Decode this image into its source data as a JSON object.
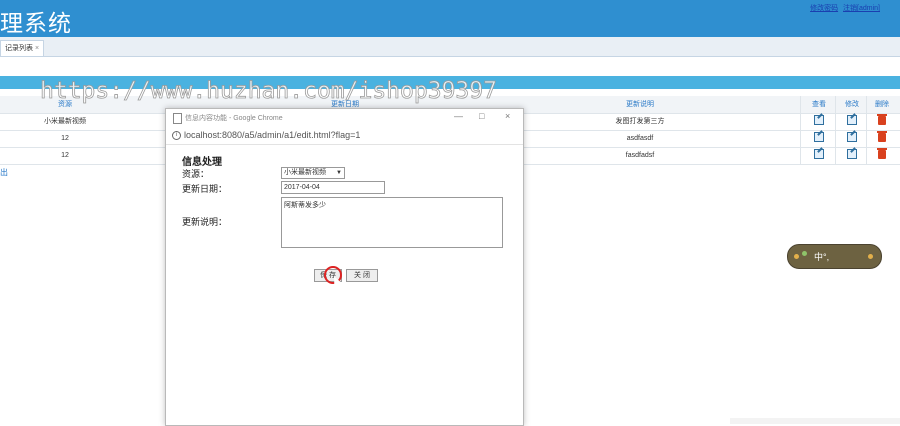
{
  "header": {
    "title": "理系统",
    "links": [
      "修改密码",
      "注销[admin]"
    ]
  },
  "tabs": [
    {
      "label": "记录列表",
      "close": "×"
    }
  ],
  "table": {
    "headers": [
      "资源",
      "更新日期",
      "更新说明",
      "查看",
      "修改",
      "删除"
    ],
    "rows": [
      {
        "resource": "小米最新视频",
        "desc": "发图打发第三方"
      },
      {
        "resource": "12",
        "desc": "asdfasdf"
      },
      {
        "resource": "12",
        "desc": "fasdfadsf"
      }
    ]
  },
  "back_link": "出",
  "watermark": "https://www.huzhan.com/ishop39397",
  "popup": {
    "window_title": "信息内容功能 - Google Chrome",
    "controls": [
      "—",
      "□",
      "×"
    ],
    "url": "localhost:8080/a5/admin/a1/edit.html?flag=1",
    "form_title": "信息处理",
    "resource_label": "资源：",
    "resource_value": "小米最新视频",
    "date_label": "更新日期：",
    "date_value": "2017-04-04",
    "desc_label": "更新说明：",
    "desc_value": "阿斯蒂发多少",
    "save_button": "保 存",
    "close_button": "关 闭"
  },
  "ime": {
    "text": "中°,"
  },
  "colors": {
    "header": "#2f8fd0",
    "band": "#4ab2e0",
    "link": "#2a7ac8",
    "delete": "#d9411e"
  }
}
